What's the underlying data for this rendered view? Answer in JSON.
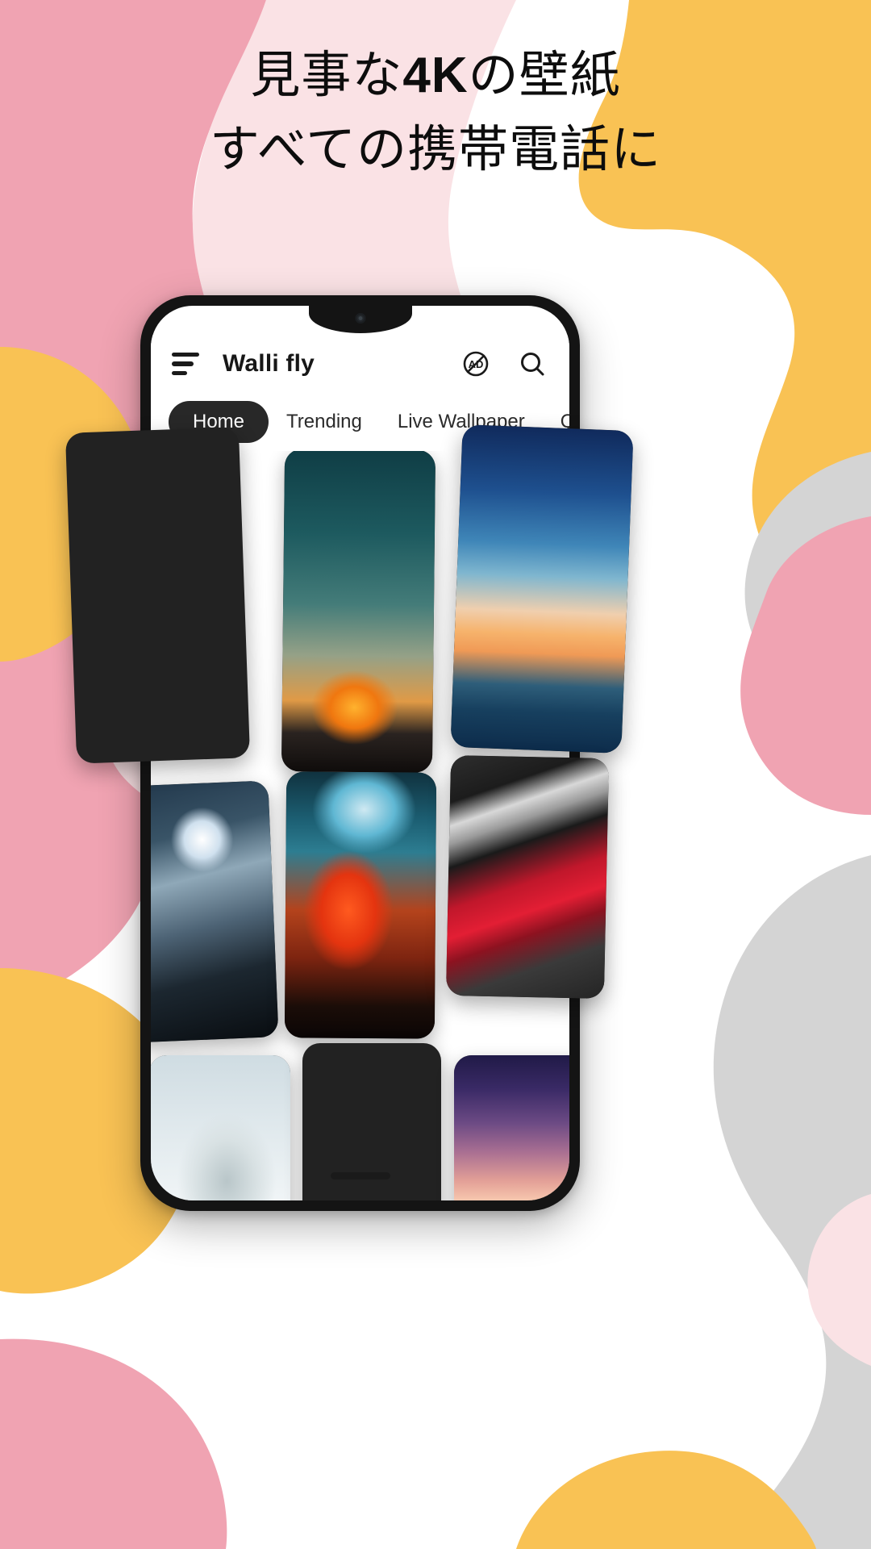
{
  "headline": {
    "line1_prefix": "見事な",
    "line1_strong": "4K",
    "line1_suffix": "の壁紙",
    "line2": "すべての携帯電話に"
  },
  "colors": {
    "pink": "#f0a3b2",
    "pink_light": "#fae2e5",
    "yellow": "#f9c254",
    "grey": "#d4d4d4",
    "white": "#ffffff",
    "accent_dark": "#282828",
    "text_dark": "#171717"
  },
  "app": {
    "title": "Walli fly",
    "menu_icon": "hamburger-menu-icon",
    "actions": [
      {
        "name": "no-ads-icon",
        "label": "AD"
      },
      {
        "name": "search-icon",
        "label": ""
      }
    ],
    "tabs": [
      {
        "label": "Home",
        "active": true
      },
      {
        "label": "Trending",
        "active": false
      },
      {
        "label": "Live Wallpaper",
        "active": false
      },
      {
        "label": "Quotes",
        "active": false
      }
    ],
    "wallpapers": [
      {
        "name": "wallpaper-girl-orange-slide",
        "art": "art-girl-slide"
      },
      {
        "name": "wallpaper-fishermen-sunset",
        "art": "art-fisher"
      },
      {
        "name": "wallpaper-lowpoly-mountain-river",
        "art": "art-lowpoly"
      },
      {
        "name": "wallpaper-skyscraper-upward",
        "art": "art-city"
      },
      {
        "name": "wallpaper-hand-on-wet-glass",
        "art": "art-hand"
      },
      {
        "name": "wallpaper-red-classic-car",
        "art": "art-car"
      },
      {
        "name": "wallpaper-rain-drops-tree",
        "art": "art-rain"
      },
      {
        "name": "wallpaper-skillet-food",
        "art": "art-food"
      },
      {
        "name": "wallpaper-pastel-sunset-sea",
        "art": "art-sunset"
      }
    ]
  }
}
